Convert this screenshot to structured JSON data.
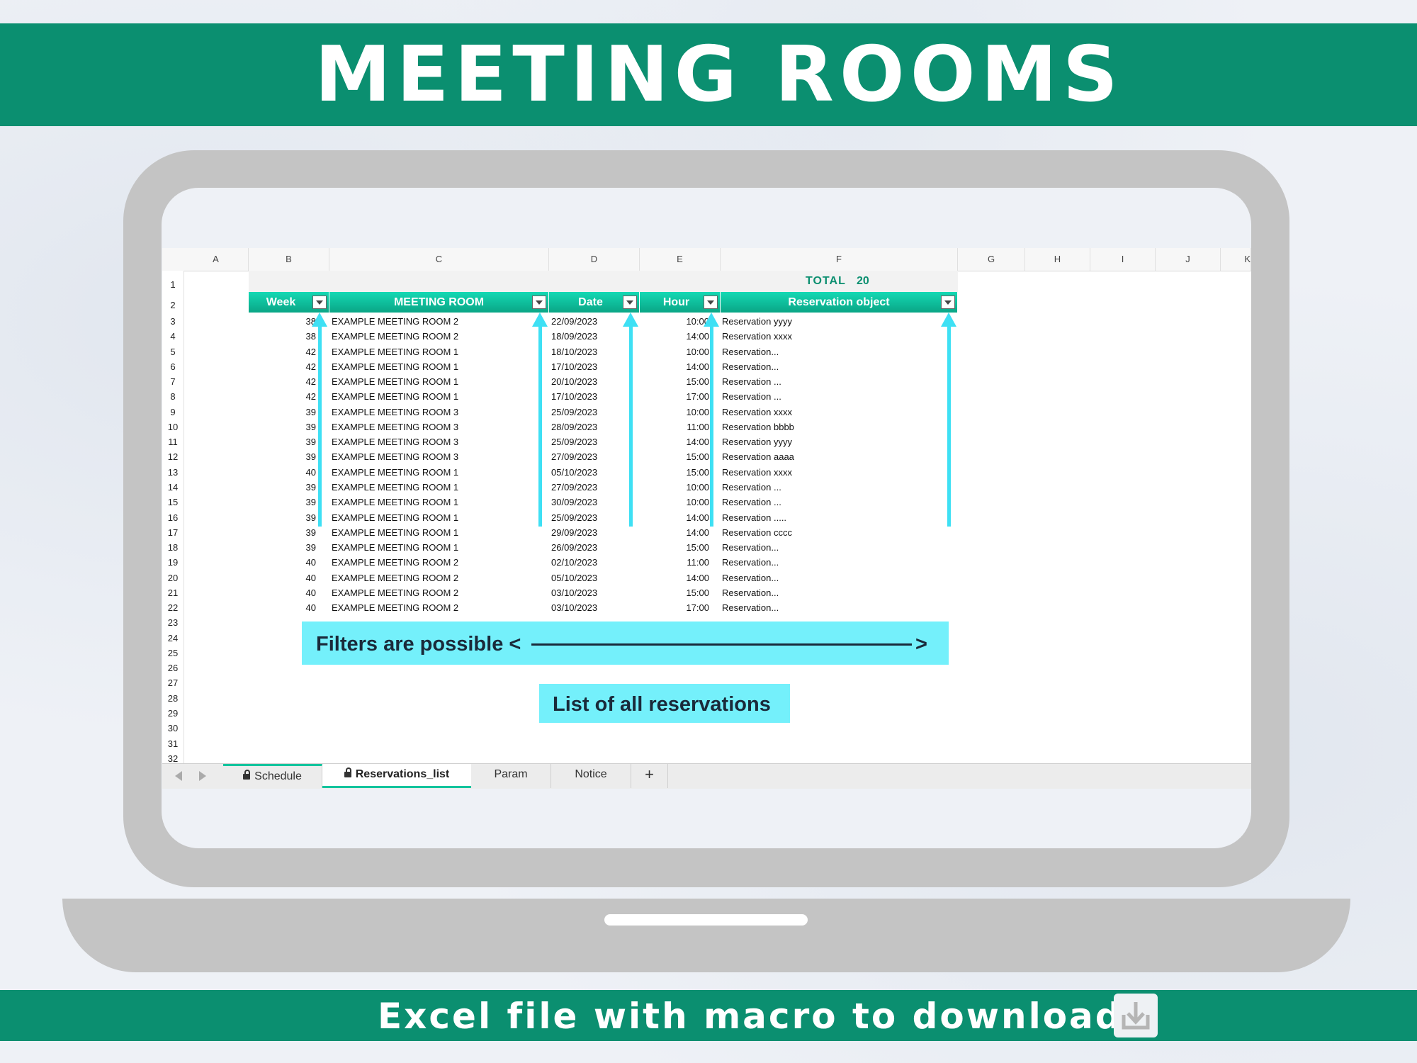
{
  "banner_title": "MEETING ROOMS",
  "footer_text": "Excel file with macro to download",
  "icons": {
    "download": "download-icon",
    "filter": "filter-dropdown-icon",
    "lock": "lock-icon",
    "nav_prev": "triangle-left-icon",
    "nav_next": "triangle-right-icon"
  },
  "colors": {
    "banner": "#0b8f70",
    "header_gradient_top": "#14d9b4",
    "header_gradient_bottom": "#0aa585",
    "arrow": "#3ee0f4",
    "callout": "#74f0fb",
    "total_text": "#0b8f70"
  },
  "sheet": {
    "columns": [
      "A",
      "B",
      "C",
      "D",
      "E",
      "F",
      "G",
      "H",
      "I",
      "J",
      "K"
    ],
    "row_numbers": [
      "1",
      "2",
      "3",
      "4",
      "5",
      "6",
      "7",
      "8",
      "9",
      "10",
      "11",
      "12",
      "13",
      "14",
      "15",
      "16",
      "17",
      "18",
      "19",
      "20",
      "21",
      "22",
      "23",
      "24",
      "25",
      "26",
      "27",
      "28",
      "29",
      "30",
      "31",
      "32"
    ],
    "total_label": "TOTAL",
    "total_value": "20",
    "headers": {
      "week": "Week",
      "room": "MEETING ROOM",
      "date": "Date",
      "hour": "Hour",
      "object": "Reservation object"
    },
    "rows": [
      [
        "38",
        "EXAMPLE MEETING ROOM 2",
        "22/09/2023",
        "10:00",
        "Reservation yyyy"
      ],
      [
        "38",
        "EXAMPLE MEETING ROOM 2",
        "18/09/2023",
        "14:00",
        "Reservation xxxx"
      ],
      [
        "42",
        "EXAMPLE MEETING ROOM 1",
        "18/10/2023",
        "10:00",
        "Reservation..."
      ],
      [
        "42",
        "EXAMPLE MEETING ROOM 1",
        "17/10/2023",
        "14:00",
        "Reservation..."
      ],
      [
        "42",
        "EXAMPLE MEETING ROOM 1",
        "20/10/2023",
        "15:00",
        "Reservation ..."
      ],
      [
        "42",
        "EXAMPLE MEETING ROOM 1",
        "17/10/2023",
        "17:00",
        "Reservation ..."
      ],
      [
        "39",
        "EXAMPLE MEETING ROOM 3",
        "25/09/2023",
        "10:00",
        "Reservation xxxx"
      ],
      [
        "39",
        "EXAMPLE MEETING ROOM 3",
        "28/09/2023",
        "11:00",
        "Reservation bbbb"
      ],
      [
        "39",
        "EXAMPLE MEETING ROOM 3",
        "25/09/2023",
        "14:00",
        "Reservation yyyy"
      ],
      [
        "39",
        "EXAMPLE MEETING ROOM 3",
        "27/09/2023",
        "15:00",
        "Reservation aaaa"
      ],
      [
        "40",
        "EXAMPLE MEETING ROOM 1",
        "05/10/2023",
        "15:00",
        "Reservation xxxx"
      ],
      [
        "39",
        "EXAMPLE MEETING ROOM 1",
        "27/09/2023",
        "10:00",
        "Reservation ..."
      ],
      [
        "39",
        "EXAMPLE MEETING ROOM 1",
        "30/09/2023",
        "10:00",
        "Reservation ..."
      ],
      [
        "39",
        "EXAMPLE MEETING ROOM 1",
        "25/09/2023",
        "14:00",
        "Reservation ....."
      ],
      [
        "39",
        "EXAMPLE MEETING ROOM 1",
        "29/09/2023",
        "14:00",
        "Reservation cccc"
      ],
      [
        "39",
        "EXAMPLE MEETING ROOM 1",
        "26/09/2023",
        "15:00",
        "Reservation..."
      ],
      [
        "40",
        "EXAMPLE MEETING ROOM 2",
        "02/10/2023",
        "11:00",
        "Reservation..."
      ],
      [
        "40",
        "EXAMPLE MEETING ROOM 2",
        "05/10/2023",
        "14:00",
        "Reservation..."
      ],
      [
        "40",
        "EXAMPLE MEETING ROOM 2",
        "03/10/2023",
        "15:00",
        "Reservation..."
      ],
      [
        "40",
        "EXAMPLE MEETING ROOM 2",
        "03/10/2023",
        "17:00",
        "Reservation..."
      ]
    ],
    "callout_filters": "Filters are possible <",
    "callout_filters_end": ">",
    "callout_list": "List of all reservations",
    "tabs": [
      "Schedule",
      "Reservations_list",
      "Param",
      "Notice"
    ],
    "add_tab": "+",
    "active_tab": "Reservations_list"
  }
}
